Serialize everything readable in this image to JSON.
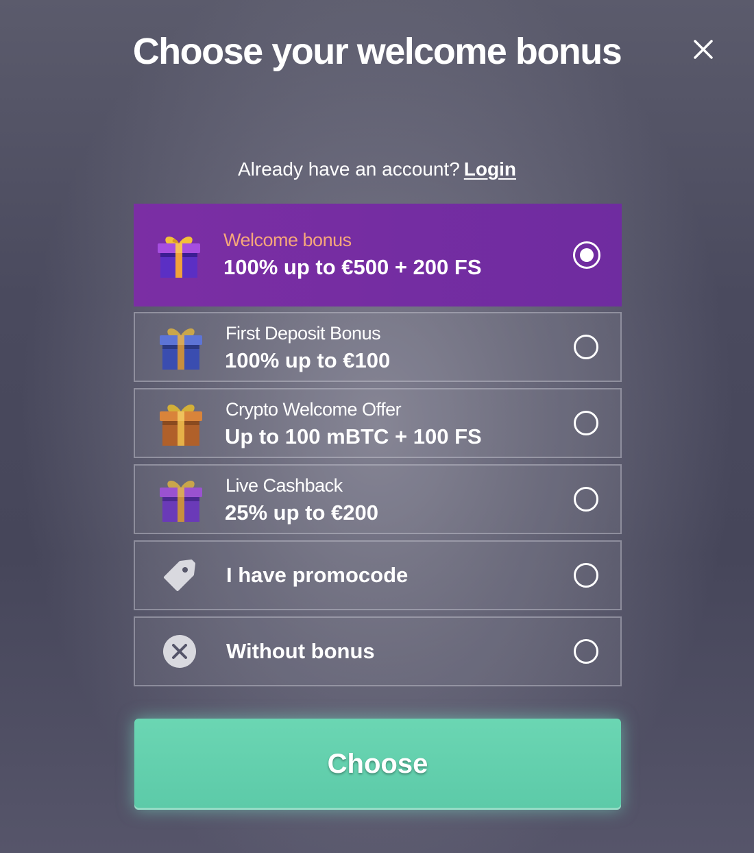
{
  "dialog": {
    "title": "Choose your welcome bonus",
    "account_prompt": "Already have an account?",
    "login_link": "Login",
    "choose_button": "Choose"
  },
  "options": [
    {
      "label": "Welcome bonus",
      "value": "100% up to €500 + 200 FS",
      "icon": "gift-purple-icon",
      "selected": true
    },
    {
      "label": "First Deposit Bonus",
      "value": "100% up to €100",
      "icon": "gift-blue-icon",
      "selected": false
    },
    {
      "label": "Crypto Welcome Offer",
      "value": "Up to 100 mBTC + 100 FS",
      "icon": "gift-orange-icon",
      "selected": false
    },
    {
      "label": "Live Cashback",
      "value": "25% up to €200",
      "icon": "gift-purple-icon",
      "selected": false
    },
    {
      "label": "I have promocode",
      "icon": "tag-icon",
      "selected": false
    },
    {
      "label": "Without bonus",
      "icon": "x-circle-icon",
      "selected": false
    }
  ],
  "colors": {
    "selected_bg": "#7b2ea4",
    "selected_label": "#f6a77a",
    "choose_button": "#5ccaa8"
  }
}
